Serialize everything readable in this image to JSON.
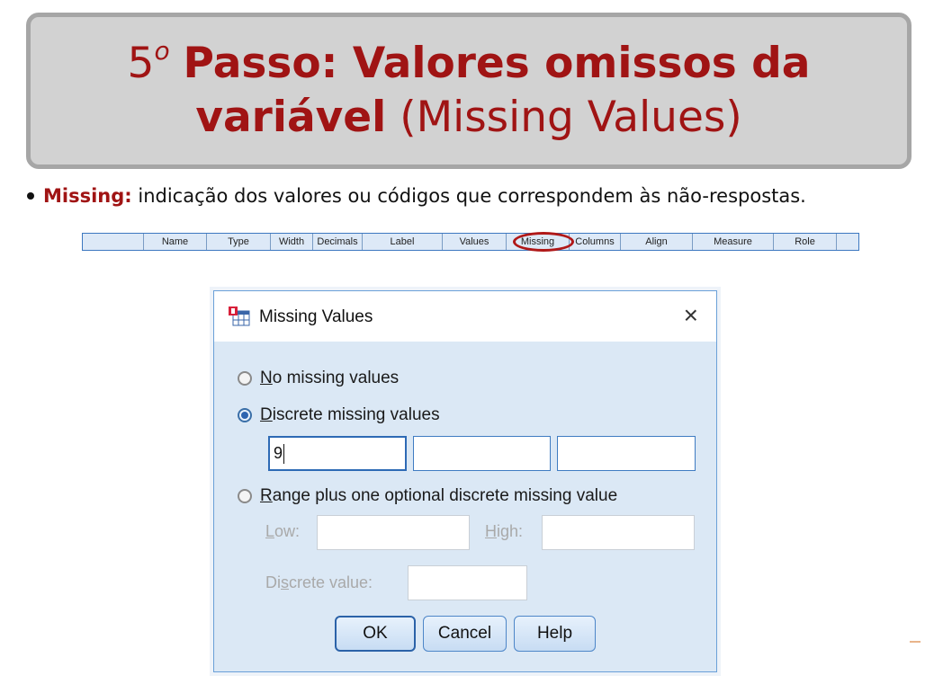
{
  "slide": {
    "title_number": "5",
    "title_superscript": "o",
    "title_bold_1": "Passo: Valores omissos da",
    "title_bold_2": "variável",
    "title_normal_2": "(Missing Values)"
  },
  "bullet": {
    "term": "Missing:",
    "text": "indicação dos valores ou códigos que correspondem às não-respostas."
  },
  "variable_header": {
    "columns": [
      "",
      "Name",
      "Type",
      "Width",
      "Decimals",
      "Label",
      "Values",
      "Missing",
      "Columns",
      "Align",
      "Measure",
      "Role",
      ""
    ],
    "highlighted_column": "Missing",
    "highlight_color": "#b01818"
  },
  "dialog": {
    "title": "Missing Values",
    "close_label": "×",
    "icon": "spss-table-icon",
    "options": {
      "no_missing": {
        "hotkey": "N",
        "rest": "o missing values",
        "selected": false
      },
      "discrete": {
        "hotkey": "D",
        "rest": "iscrete missing values",
        "selected": true
      },
      "range": {
        "hotkey": "R",
        "rest": "ange plus one optional discrete missing value",
        "selected": false
      }
    },
    "discrete_values": [
      "9",
      "",
      ""
    ],
    "range": {
      "low_hotkey": "L",
      "low_rest": "ow:",
      "high_hotkey": "H",
      "high_rest": "igh:",
      "low_value": "",
      "high_value": "",
      "discrete_pre": "Di",
      "discrete_hotkey": "s",
      "discrete_rest": "crete value:",
      "discrete_value": ""
    },
    "buttons": {
      "ok": "OK",
      "cancel": "Cancel",
      "help": "Help"
    }
  }
}
